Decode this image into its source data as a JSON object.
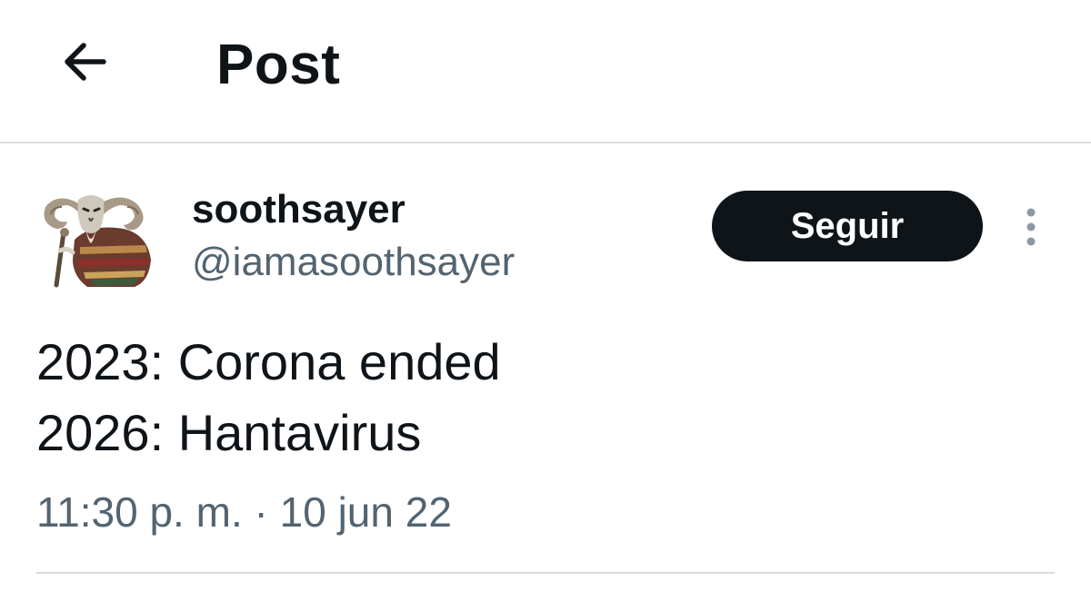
{
  "header": {
    "back_icon": "arrow-left-icon",
    "title": "Post"
  },
  "author": {
    "display_name": "soothsayer",
    "handle": "@iamasoothsayer",
    "avatar_icon": "ram-horned-character-avatar"
  },
  "follow_button": {
    "label": "Seguir",
    "background": "#0f1419",
    "text_color": "#ffffff"
  },
  "more_icon": "more-vertical-icon",
  "tweet": {
    "lines": [
      "2023: Corona ended",
      "2026: Hantavirus"
    ],
    "time": "11:30 p. m.",
    "separator": "·",
    "date": "10 jun 22"
  },
  "colors": {
    "text_primary": "#0f1419",
    "text_secondary": "#536471",
    "divider": "#d9dcdf"
  }
}
